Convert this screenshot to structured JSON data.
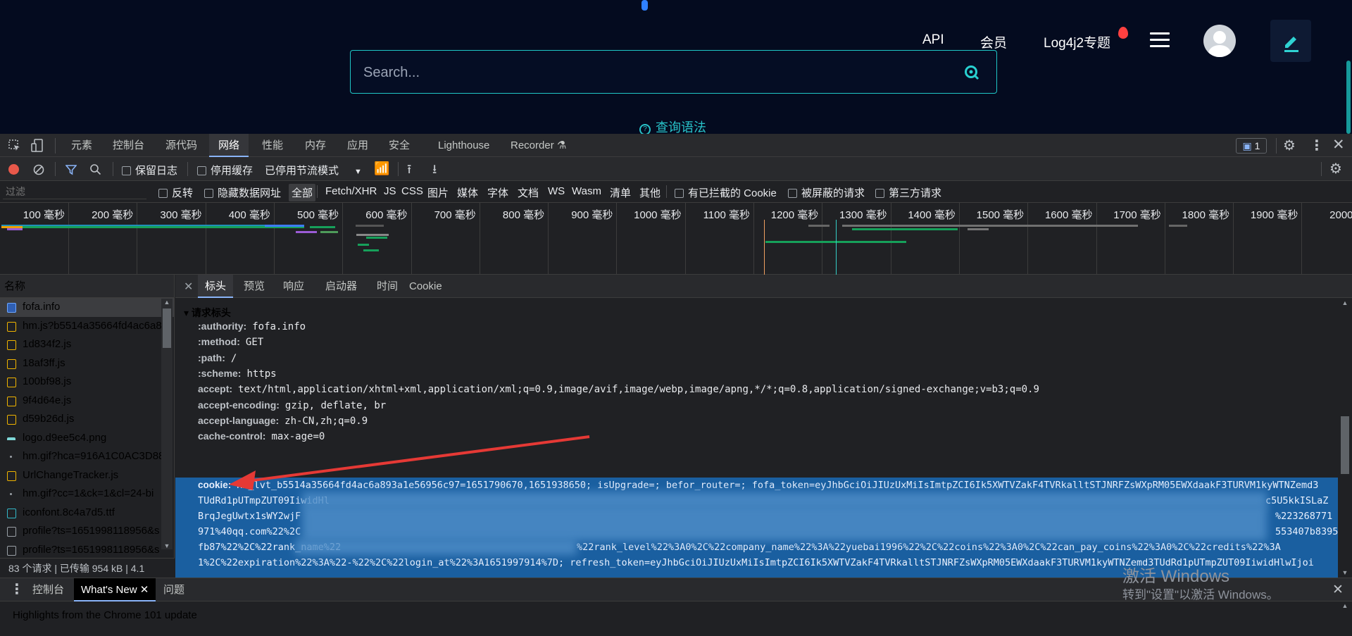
{
  "site": {
    "nav": {
      "api": "API",
      "member": "会员",
      "log4j": "Log4j2专题"
    },
    "search_placeholder": "Search...",
    "syntax_link": "查询语法"
  },
  "devtools": {
    "main_tabs": [
      "元素",
      "控制台",
      "源代码",
      "网络",
      "性能",
      "内存",
      "应用",
      "安全",
      "Lighthouse",
      "Recorder"
    ],
    "active_tab": "网络",
    "issues_count": "1",
    "toolbar": {
      "preserve_log": "保留日志",
      "disable_cache": "停用缓存",
      "throttling": "已停用节流模式"
    },
    "filter": {
      "placeholder": "过滤",
      "invert": "反转",
      "hide_data_urls": "隐藏数据网址",
      "types": [
        "全部",
        "Fetch/XHR",
        "JS",
        "CSS",
        "图片",
        "媒体",
        "字体",
        "文档",
        "WS",
        "Wasm",
        "清单",
        "其他"
      ],
      "blocked_cookies": "有已拦截的 Cookie",
      "blocked_requests": "被屏蔽的请求",
      "third_party": "第三方请求"
    },
    "timeline_ticks": [
      "100 毫秒",
      "200 毫秒",
      "300 毫秒",
      "400 毫秒",
      "500 毫秒",
      "600 毫秒",
      "700 毫秒",
      "800 毫秒",
      "900 毫秒",
      "1000 毫秒",
      "1100 毫秒",
      "1200 毫秒",
      "1300 毫秒",
      "1400 毫秒",
      "1500 毫秒",
      "1600 毫秒",
      "1700 毫秒",
      "1800 毫秒",
      "1900 毫秒",
      "2000 毫"
    ],
    "requests": {
      "column_name": "名称",
      "items": [
        {
          "name": "fofa.info",
          "type": "doc"
        },
        {
          "name": "hm.js?b5514a35664fd4ac6a8",
          "type": "js"
        },
        {
          "name": "1d834f2.js",
          "type": "js"
        },
        {
          "name": "18af3ff.js",
          "type": "js"
        },
        {
          "name": "100bf98.js",
          "type": "js"
        },
        {
          "name": "9f4d64e.js",
          "type": "js"
        },
        {
          "name": "d59b26d.js",
          "type": "js"
        },
        {
          "name": "logo.d9ee5c4.png",
          "type": "img"
        },
        {
          "name": "hm.gif?hca=916A1C0AC3D88",
          "type": "dot"
        },
        {
          "name": "UrlChangeTracker.js",
          "type": "js"
        },
        {
          "name": "hm.gif?cc=1&ck=1&cl=24-bi",
          "type": "dot"
        },
        {
          "name": "iconfont.8c4a7d5.ttf",
          "type": "font"
        },
        {
          "name": "profile?ts=1651998118956&s",
          "type": "blank"
        },
        {
          "name": "profile?ts=1651998118956&s",
          "type": "blank"
        }
      ],
      "summary": "83 个请求 | 已传输 954 kB | 4.1"
    },
    "detail_tabs": [
      "标头",
      "预览",
      "响应",
      "启动器",
      "时间",
      "Cookie"
    ],
    "active_detail_tab": "标头",
    "section_title": "▾ 请求标头",
    "headers": [
      {
        "key": ":authority:",
        "value": "fofa.info"
      },
      {
        "key": ":method:",
        "value": "GET"
      },
      {
        "key": ":path:",
        "value": "/"
      },
      {
        "key": ":scheme:",
        "value": "https"
      },
      {
        "key": "accept:",
        "value": "text/html,application/xhtml+xml,application/xml;q=0.9,image/avif,image/webp,image/apng,*/*;q=0.8,application/signed-exchange;v=b3;q=0.9"
      },
      {
        "key": "accept-encoding:",
        "value": "gzip, deflate, br"
      },
      {
        "key": "accept-language:",
        "value": "zh-CN,zh;q=0.9"
      },
      {
        "key": "cache-control:",
        "value": "max-age=0"
      }
    ],
    "cookie": {
      "key": "cookie:",
      "lines": [
        "Hm_lvt_b5514a35664fd4ac6a893a1e56956c97=1651790670,1651938650; isUpgrade=; befor_router=; fofa_token=eyJhbGciOiJIUzUxMiIsImtpZCI6Ik5XWTVZakF4TVRkalltSTJNRFZsWXpRM05EWXdaakF3TURVM1kyWTNZemd3",
        "TUdRd1pUTmpZUT09IiwidHl",
        "BrqJegUwtx1sWY2wjF",
        "971%40qq.com%22%2C",
        "fb87%22%2C%22rank_name%22",
        "1%2C%22expiration%22%3A%22-%22%2C%22login_at%22%3A1651997914%7D; refresh_token=eyJhbGciOiJIUzUxMiIsImtpZCI6Ik5XWTVZakF4TVRkalltSTJNRFZsWXpRM05EWXdaakF3TURVM1kyWTNZemd3TUdRd1pUTmpZUT09IiwidHlwIjoi"
      ],
      "right_fragments": [
        "c5U5kkISLaZ",
        "%223268771",
        "553407b8395"
      ],
      "mid_fragment": "%22rank_level%22%3A0%2C%22company_name%22%3A%22yuebai1996%22%2C%22coins%22%3A0%2C%22can_pay_coins%22%3A0%2C%22credits%22%3A"
    },
    "drawer": {
      "tabs": [
        "控制台",
        "What's New",
        "问题"
      ],
      "active": "What's New",
      "content": "Highlights from the Chrome 101 update"
    },
    "watermark": {
      "line1": "激活 Windows",
      "line2": "转到\"设置\"以激活 Windows。"
    }
  },
  "colors": {
    "site_bg": "#040b1f",
    "accent": "#28c3c9",
    "selection": "#1a5fa0",
    "arrow": "#e53935"
  }
}
